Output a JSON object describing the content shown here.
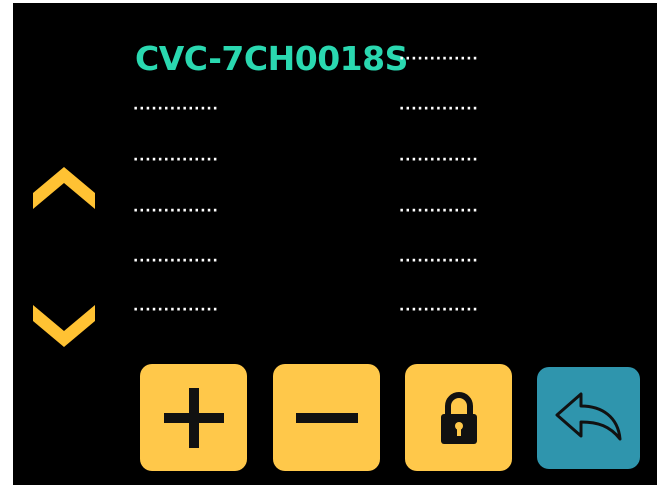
{
  "device": {
    "model_label": "CVC-7CH0018S",
    "title_value": "·············",
    "rows": [
      {
        "left": "··············",
        "right": "·············"
      },
      {
        "left": "··············",
        "right": "·············"
      },
      {
        "left": "··············",
        "right": "·············"
      },
      {
        "left": "··············",
        "right": "·············"
      },
      {
        "left": "··············",
        "right": "·············"
      }
    ]
  },
  "navigation": {
    "scroll_up_icon": "chevron-up-icon",
    "scroll_down_icon": "chevron-down-icon"
  },
  "buttons": [
    {
      "name": "increase-button",
      "icon": "plus-icon"
    },
    {
      "name": "decrease-button",
      "icon": "minus-icon"
    },
    {
      "name": "lock-button",
      "icon": "lock-icon"
    },
    {
      "name": "back-button",
      "icon": "back-arrow-icon"
    }
  ],
  "colors": {
    "background": "#000000",
    "title_accent": "#2ad8b0",
    "placeholder_text": "#ffffff",
    "arrow": "#ffc233",
    "button_yellow": "#ffc84a",
    "button_teal": "#2f95ad",
    "icon_dark": "#111111"
  }
}
